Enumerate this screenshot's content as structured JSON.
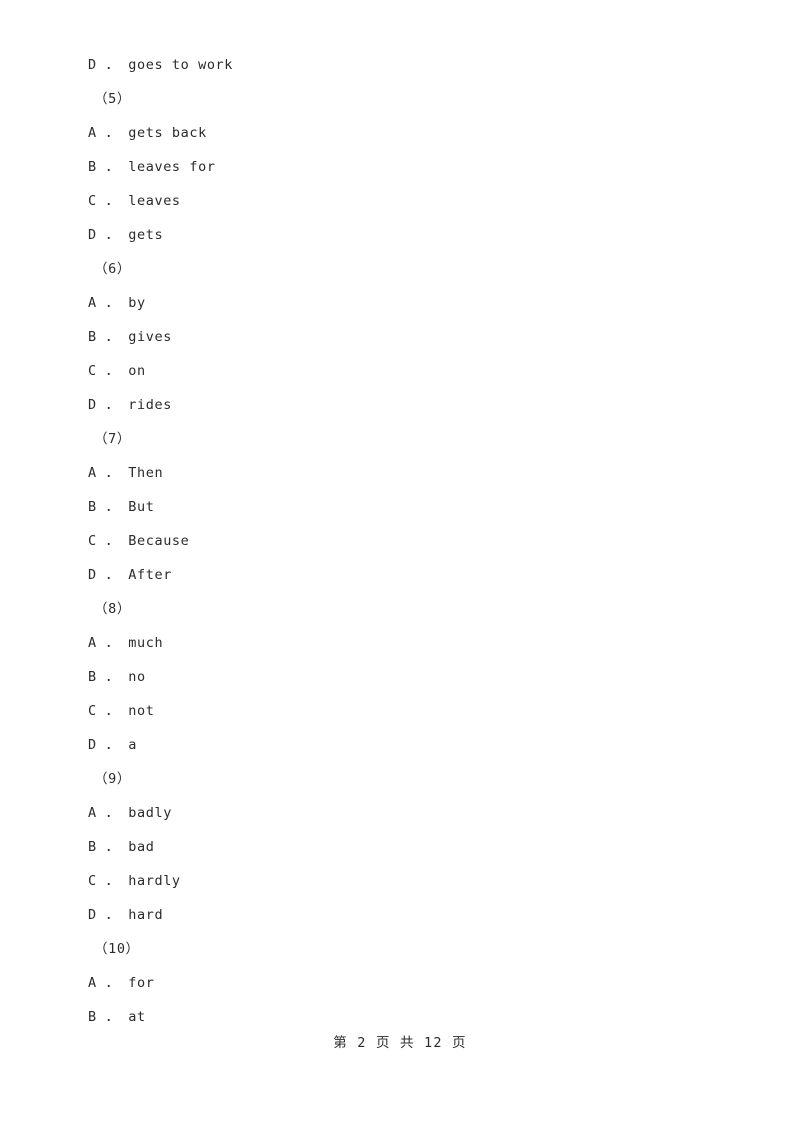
{
  "document": {
    "type": "exam-paper",
    "background_color": "#ffffff",
    "text_color": "#2b2b2b"
  },
  "lines": [
    {
      "kind": "option",
      "text": "D ． goes to work"
    },
    {
      "kind": "question",
      "text": "（5）"
    },
    {
      "kind": "option",
      "text": "A ． gets back"
    },
    {
      "kind": "option",
      "text": "B ． leaves for"
    },
    {
      "kind": "option",
      "text": "C ． leaves"
    },
    {
      "kind": "option",
      "text": "D ． gets"
    },
    {
      "kind": "question",
      "text": "（6）"
    },
    {
      "kind": "option",
      "text": "A ． by"
    },
    {
      "kind": "option",
      "text": "B ． gives"
    },
    {
      "kind": "option",
      "text": "C ． on"
    },
    {
      "kind": "option",
      "text": "D ． rides"
    },
    {
      "kind": "question",
      "text": "（7）"
    },
    {
      "kind": "option",
      "text": "A ． Then"
    },
    {
      "kind": "option",
      "text": "B ． But"
    },
    {
      "kind": "option",
      "text": "C ． Because"
    },
    {
      "kind": "option",
      "text": "D ． After"
    },
    {
      "kind": "question",
      "text": "（8）"
    },
    {
      "kind": "option",
      "text": "A ． much"
    },
    {
      "kind": "option",
      "text": "B ． no"
    },
    {
      "kind": "option",
      "text": "C ． not"
    },
    {
      "kind": "option",
      "text": "D ． a"
    },
    {
      "kind": "question",
      "text": "（9）"
    },
    {
      "kind": "option",
      "text": "A ． badly"
    },
    {
      "kind": "option",
      "text": "B ． bad"
    },
    {
      "kind": "option",
      "text": "C ． hardly"
    },
    {
      "kind": "option",
      "text": "D ． hard"
    },
    {
      "kind": "question",
      "text": "（10）"
    },
    {
      "kind": "option",
      "text": "A ． for"
    },
    {
      "kind": "option",
      "text": "B ． at"
    }
  ],
  "footer": {
    "text": "第 2 页 共 12 页",
    "current_page": "2",
    "total_pages": "12"
  }
}
